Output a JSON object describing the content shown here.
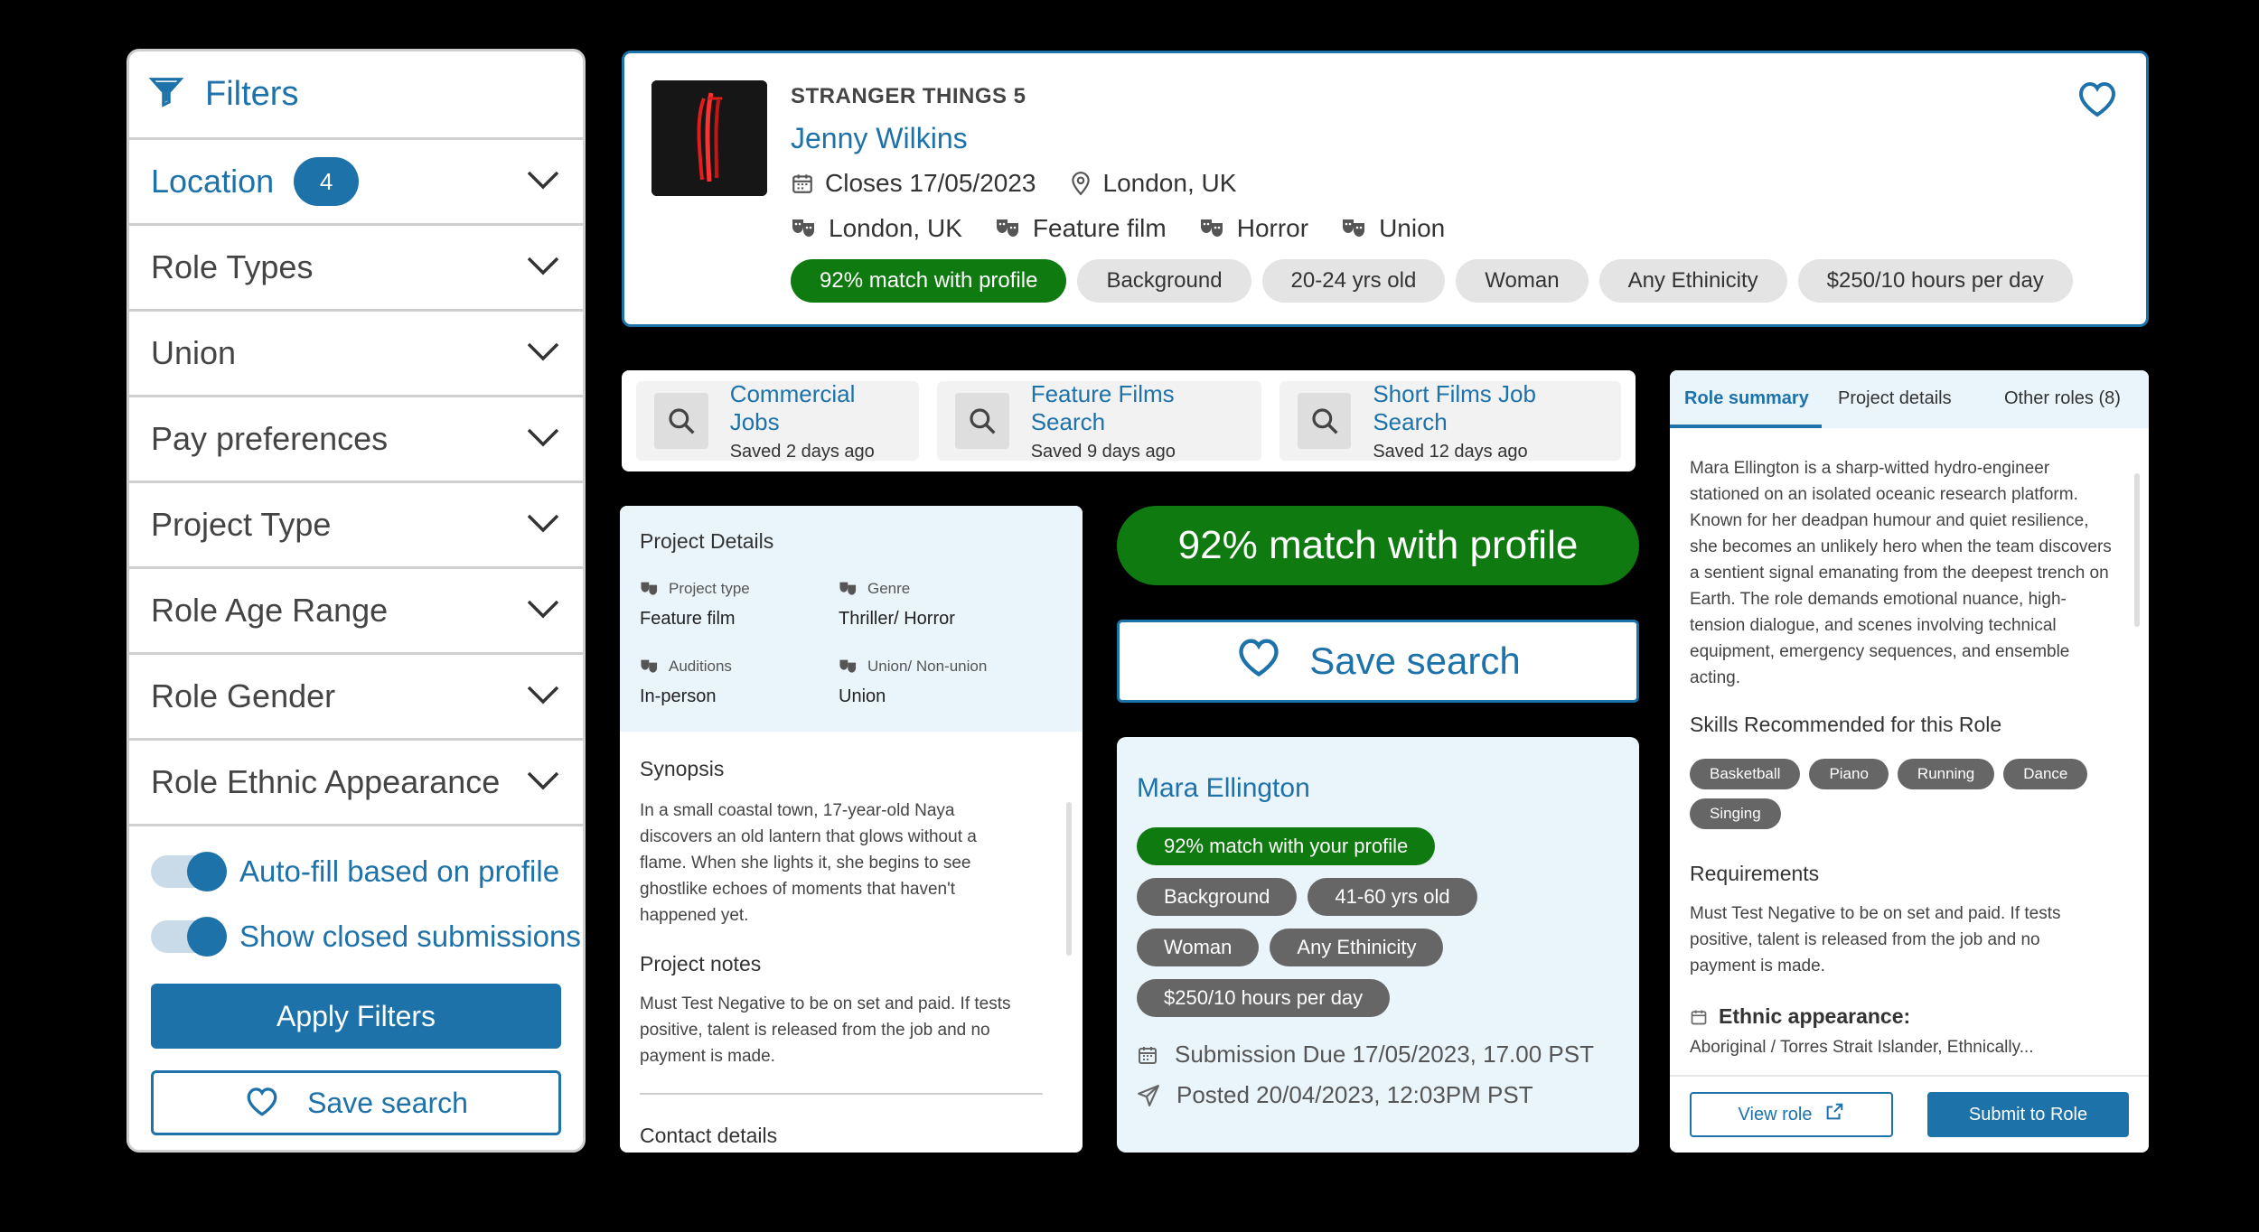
{
  "colors": {
    "primary": "#1d72aa",
    "match_green": "#0f7a0f",
    "chip_gray": "#e4e4e4",
    "dark_chip": "#666666",
    "light_panel": "#eaf4fb"
  },
  "filters": {
    "title": "Filters",
    "location": {
      "label": "Location",
      "count": "4"
    },
    "rows": [
      "Role Types",
      "Union",
      "Pay preferences",
      "Project Type",
      "Role Age Range",
      "Role Gender",
      "Role Ethnic Appearance"
    ],
    "toggles": [
      "Auto-fill based on profile",
      "Show closed submissions"
    ],
    "apply_label": "Apply Filters",
    "save_label": "Save search"
  },
  "project": {
    "eyebrow": "STRANGER THINGS 5",
    "name": "Jenny Wilkins",
    "closes": "Closes 17/05/2023",
    "location": "London, UK",
    "tags": [
      "London, UK",
      "Feature film",
      "Horror",
      "Union"
    ],
    "chips": [
      "92% match with profile",
      "Background",
      "20-24 yrs old",
      "Woman",
      "Any Ethinicity",
      "$250/10 hours per day"
    ]
  },
  "saved_searches": [
    {
      "title": "Commercial Jobs",
      "subtitle": "Saved 2 days ago"
    },
    {
      "title": "Feature Films Search",
      "subtitle": "Saved 9 days ago"
    },
    {
      "title": "Short Films Job Search",
      "subtitle": "Saved 12 days ago"
    }
  ],
  "details": {
    "title": "Project Details",
    "project_type_k": "Project type",
    "project_type_v": "Feature film",
    "genre_k": "Genre",
    "genre_v": "Thriller/ Horror",
    "auditions_k": "Auditions",
    "auditions_v": "In-person",
    "union_k": "Union/ Non-union",
    "union_v": "Union",
    "synopsis_title": "Synopsis",
    "synopsis": "In a small coastal town, 17-year-old Naya discovers an old lantern that glows without a flame. When she lights it, she begins to see ghostlike echoes of moments that haven't happened yet.",
    "notes_title": "Project notes",
    "notes": "Must Test Negative to be on set and paid. If tests positive, talent is released from the job and no payment is made.",
    "contact_title": "Contact details"
  },
  "middle": {
    "big_match": "92% match with profile",
    "save_search": "Save search",
    "person": {
      "name": "Mara Ellington",
      "chips": [
        "92% match with your profile",
        "Background",
        "41-60 yrs old",
        "Woman",
        "Any Ethinicity",
        "$250/10 hours per day"
      ],
      "due": "Submission Due 17/05/2023, 17.00 PST",
      "posted": "Posted 20/04/2023, 12:03PM PST"
    }
  },
  "role": {
    "tabs": [
      "Role summary",
      "Project details",
      "Other roles (8)"
    ],
    "summary": "Mara Ellington is a sharp-witted hydro-engineer stationed on an isolated oceanic research platform. Known for her deadpan humour and quiet resilience, she becomes an unlikely hero when the team discovers a sentient signal emanating from the deepest trench on Earth. The role demands emotional nuance, high-tension dialogue, and scenes involving technical equipment, emergency sequences, and ensemble acting.",
    "skills_title": "Skills Recommended for this Role",
    "skills": [
      "Basketball",
      "Piano",
      "Running",
      "Dance",
      "Singing"
    ],
    "requirements_title": "Requirements",
    "requirements": "Must Test Negative to be on set and paid. If tests positive, talent is released from the job and no payment is made.",
    "ethnic_title": "Ethnic appearance:",
    "ethnic_value": "Aboriginal / Torres Strait Islander, Ethnically...",
    "view_label": "View role",
    "submit_label": "Submit to Role"
  }
}
